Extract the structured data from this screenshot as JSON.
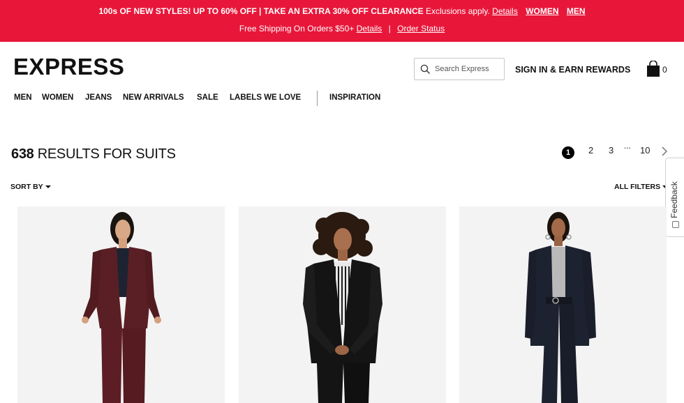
{
  "promo": {
    "headline": "100s OF NEW STYLES! UP TO 60% OFF | TAKE AN EXTRA 30% OFF CLEARANCE",
    "exclusions": "Exclusions apply.",
    "details_link": "Details",
    "women_link": "WOMEN",
    "men_link": "MEN",
    "shipping": "Free Shipping On Orders $50+",
    "shipping_details": "Details",
    "separator": "|",
    "order_status": "Order Status"
  },
  "header": {
    "logo": "EXPRESS",
    "search_placeholder": "Search Express",
    "signin": "SIGN IN & EARN REWARDS",
    "bag_count": "0",
    "bag_icon": "shopping-bag-icon",
    "search_icon": "search-icon"
  },
  "nav": {
    "items": [
      "MEN",
      "WOMEN",
      "JEANS",
      "NEW ARRIVALS",
      "SALE",
      "LABELS WE LOVE",
      "INSPIRATION"
    ]
  },
  "results": {
    "count": "638",
    "label": "RESULTS FOR SUITS",
    "sort_by": "SORT BY",
    "all_filters": "ALL FILTERS"
  },
  "pagination": {
    "pages": [
      "1",
      "2",
      "3",
      "10"
    ],
    "ellipsis": "...",
    "current": "1",
    "next_icon": "chevron-right-icon"
  },
  "feedback": {
    "label": "Feedback"
  },
  "products": [
    {
      "name": "burgundy-suit",
      "jacket_color": "#5a1f24",
      "top_color": "#1d2333",
      "pants_color": "#5c1e24"
    },
    {
      "name": "black-suit",
      "jacket_color": "#141414",
      "top_color": "#e8e8e8",
      "pants_color": "#141414"
    },
    {
      "name": "navy-suit",
      "jacket_color": "#1d2230",
      "top_color": "#b9b9b9",
      "pants_color": "#1d2230"
    }
  ],
  "colors": {
    "promo_bg": "#e8173a",
    "text": "#111111",
    "product_bg": "#f3f3f3"
  }
}
